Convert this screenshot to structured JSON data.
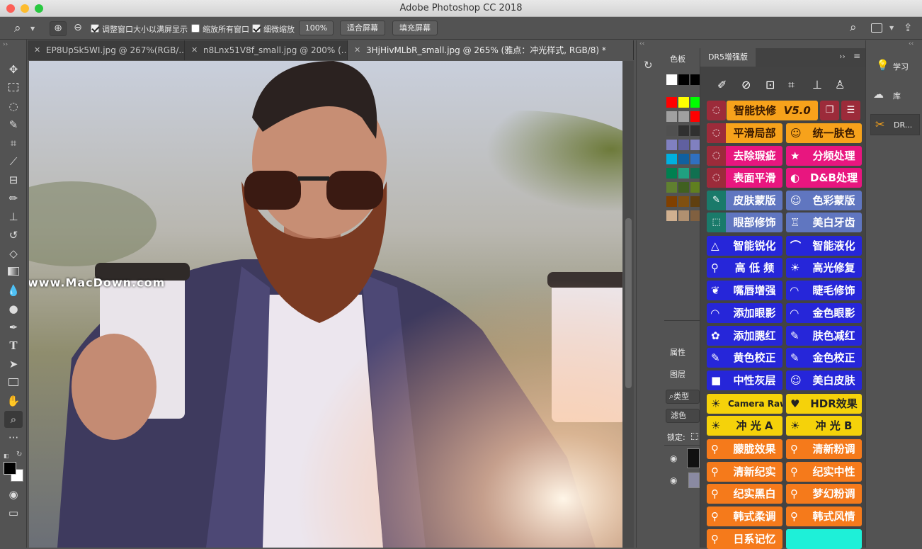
{
  "app": {
    "title": "Adobe Photoshop CC 2018"
  },
  "options": {
    "resize_windows": "调整窗口大小以满屏显示",
    "zoom_all": "缩放所有窗口",
    "scrubby_zoom": "细微缩放",
    "zoom_value": "100%",
    "fit_screen": "适合屏幕",
    "fill_screen": "填充屏幕"
  },
  "tabs": [
    {
      "label": "EP8UpSk5WI.jpg @ 267%(RGB/..."
    },
    {
      "label": "n8Lnx51V8f_small.jpg @ 200% (..."
    },
    {
      "label": "3HjHivMLbR_small.jpg @ 265% (雅点：冲光样式, RGB/8) *"
    }
  ],
  "watermark": "www.MacDown.com",
  "panels": {
    "swatches": "色板",
    "dr5_title": "DR5增强版",
    "properties": "属性",
    "layers": "图层",
    "kind": "类型",
    "filter": "滤色",
    "lock": "锁定:",
    "learn": "学习",
    "libraries": "库",
    "dr_short": "DR..."
  },
  "dr5": {
    "top_button": "智能快修",
    "version": "V5.0",
    "rows": [
      [
        "平滑局部",
        "统一肤色"
      ],
      [
        "去除瑕疵",
        "分频处理"
      ],
      [
        "表面平滑",
        "D&B处理"
      ],
      [
        "皮肤蒙版",
        "色彩蒙版"
      ],
      [
        "眼部修饰",
        "美白牙齿"
      ],
      [
        "智能锐化",
        "智能液化"
      ],
      [
        "高 低 频",
        "高光修复"
      ],
      [
        "嘴唇增强",
        "睫毛修饰"
      ],
      [
        "添加眼影",
        "金色眼影"
      ],
      [
        "添加腮红",
        "肤色减红"
      ],
      [
        "黄色校正",
        "金色校正"
      ],
      [
        "中性灰层",
        "美白皮肤"
      ],
      [
        "Camera Raw",
        "HDR效果"
      ],
      [
        "冲 光 A",
        "冲 光 B"
      ],
      [
        "朦胧效果",
        "清新粉调"
      ],
      [
        "清新纪实",
        "纪实中性"
      ],
      [
        "纪实黑白",
        "梦幻粉调"
      ],
      [
        "韩式柔调",
        "韩式风情"
      ],
      [
        "日系记忆",
        ""
      ]
    ]
  },
  "colors": {
    "accent_orange": "#f7a21b",
    "dr_blue": "#2626d9",
    "dr_pink": "#e8167f"
  }
}
